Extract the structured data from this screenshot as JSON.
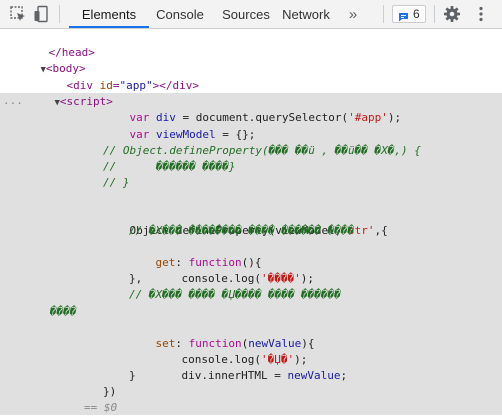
{
  "toolbar": {
    "tabs": [
      {
        "label": "Elements",
        "active": true
      },
      {
        "label": "Console",
        "active": false
      },
      {
        "label": "Sources",
        "active": false
      },
      {
        "label": "Network",
        "active": false
      }
    ],
    "more_label": "»",
    "issues_count": "6",
    "icons": [
      "inspect-icon",
      "device-toolbar-icon",
      "issues-icon",
      "settings-gear-icon",
      "more-options-icon"
    ]
  },
  "dom": {
    "line_head": "</head>",
    "line_body": "<body>",
    "div_open": "<div ",
    "div_attr_name": "id",
    "div_attr_eq": "=",
    "div_attr_value": "\"app\"",
    "div_close": "></div>",
    "script_open": "<script>",
    "ellipsis": "...",
    "eq_ref": "== $0"
  },
  "code": {
    "l1_kw": "var",
    "l1_var": " div ",
    "l1_mid": "= document.querySelector(",
    "l1_str": "'#app'",
    "l1_end": ");",
    "l2_kw": "var",
    "l2_var": " viewModel ",
    "l2_end": "= {};",
    "l3_cm": "// Object.defineProperty(��� ��ü , ��ü�� �X�,) {",
    "l4_cm": "//      ������ ����}",
    "l5_cm": "// }",
    "l6_plain": "Object.defineProperty(viewModel,",
    "l6_str": "'str'",
    "l6_end": ",{",
    "l7_cm": "// �X��� �������� ���� ������ ����",
    "l8_attr": "get",
    "l8_mid": ": ",
    "l8_kw": "function",
    "l8_end": "(){",
    "l9_plain": "console.log(",
    "l9_str": "'����'",
    "l9_end": ");",
    "l10_plain": "},",
    "l11_cm": "// �X��� ���� �Џ���� ���� ������",
    "l12_cm": "����",
    "l13_attr": "set",
    "l13_mid": ": ",
    "l13_kw": "function",
    "l13_open": "(",
    "l13_var": "newValue",
    "l13_end": "){",
    "l14_plain": "console.log(",
    "l14_str": "'�Џ�'",
    "l14_end": ");",
    "l15_plain": "div.innerHTML = ",
    "l15_var": "newValue",
    "l15_end": ";",
    "l16_plain": "}",
    "l17_plain": "})"
  },
  "colors": {
    "active_tab_underline": "#1a73e8",
    "issues_blue": "#1a73e8",
    "selection_bg": "#e0e0e0",
    "tag": "#881280",
    "attr": "#994500",
    "string": "#c41a16",
    "comment": "#236e25"
  }
}
